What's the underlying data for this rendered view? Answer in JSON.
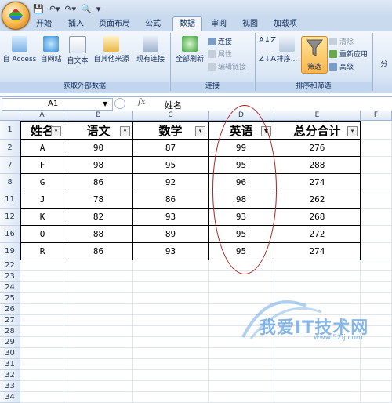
{
  "ribbon": {
    "tabs": [
      "开始",
      "插入",
      "页面布局",
      "公式",
      "数据",
      "审阅",
      "视图",
      "加载项"
    ],
    "active_tab": "数据",
    "get_external": [
      "自 Access",
      "自网站",
      "自文本",
      "自其他来源",
      "现有连接"
    ],
    "group_get_external": "获取外部数据",
    "refresh_all": "全部刷新",
    "connections_small": [
      "连接",
      "属性",
      "编辑链接"
    ],
    "group_connections": "连接",
    "sort": "排序...",
    "filter": "筛选",
    "filter_small": [
      "清除",
      "重新应用",
      "高级"
    ],
    "group_sort_filter": "排序和筛选",
    "cut_off": "分"
  },
  "formula_bar": {
    "name_box": "A1",
    "fx": "fx",
    "value": "姓名"
  },
  "sheet": {
    "columns": [
      "A",
      "B",
      "C",
      "D",
      "E",
      "F"
    ],
    "headers": [
      "姓名",
      "语文",
      "数学",
      "英语",
      "总分合计"
    ],
    "rows": [
      {
        "num": "1"
      },
      {
        "num": "2",
        "cells": [
          "A",
          "90",
          "87",
          "99",
          "276"
        ]
      },
      {
        "num": "7",
        "cells": [
          "F",
          "98",
          "95",
          "95",
          "288"
        ]
      },
      {
        "num": "8",
        "cells": [
          "G",
          "86",
          "92",
          "96",
          "274"
        ]
      },
      {
        "num": "11",
        "cells": [
          "J",
          "78",
          "86",
          "98",
          "262"
        ]
      },
      {
        "num": "12",
        "cells": [
          "K",
          "82",
          "93",
          "93",
          "268"
        ]
      },
      {
        "num": "16",
        "cells": [
          "O",
          "88",
          "89",
          "95",
          "272"
        ]
      },
      {
        "num": "19",
        "cells": [
          "R",
          "86",
          "93",
          "95",
          "274"
        ]
      },
      {
        "num": "22"
      },
      {
        "num": "23"
      },
      {
        "num": "24"
      },
      {
        "num": "25"
      },
      {
        "num": "26"
      },
      {
        "num": "27"
      },
      {
        "num": "28"
      },
      {
        "num": "29"
      },
      {
        "num": "30"
      },
      {
        "num": "31"
      },
      {
        "num": "32"
      },
      {
        "num": "33"
      },
      {
        "num": "34"
      }
    ]
  },
  "watermark": {
    "text": "我爱IT技术网",
    "url": "www.52ij.com"
  },
  "colors": {
    "ribbon": "#dbe7f5",
    "accent": "#f8b54c",
    "ellipse": "#b02020"
  }
}
